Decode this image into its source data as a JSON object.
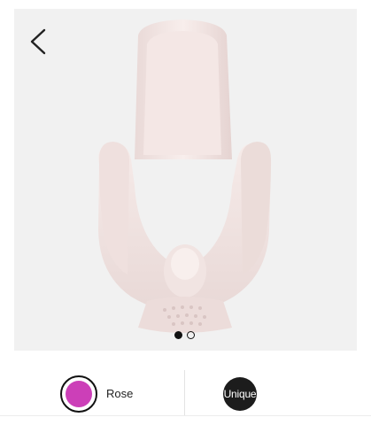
{
  "product": {
    "image_description_icon": "bath-seat-image",
    "carousel": {
      "total": 2,
      "active_index": 0
    }
  },
  "navigation": {
    "back_icon": "chevron-left-icon"
  },
  "options": {
    "color": {
      "label": "Rose",
      "swatch_color": "#cc3fb8"
    },
    "size": {
      "label": "Unique"
    }
  },
  "colors": {
    "hero_background": "#f1f1f1",
    "seat_color": "#f3e6e4",
    "dot_active": "#111111"
  }
}
